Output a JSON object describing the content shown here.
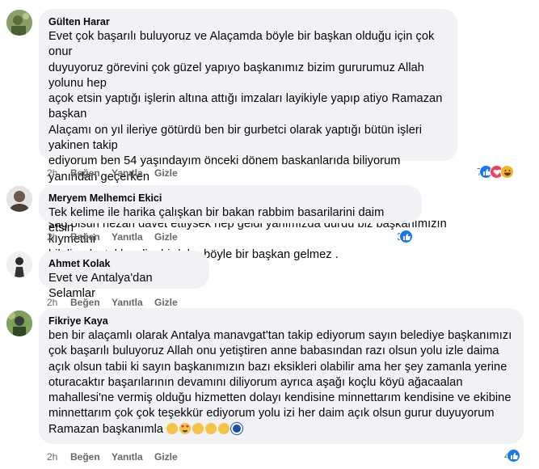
{
  "comments": [
    {
      "author": "Gülten Harar",
      "text": "Evet çok başarılı buluyoruz ve Alaçamda böyle bir başkan olduğu için çok onur\nduyuyoruz görevini çok güzel yapıyo başkanımız bizim gururumuz Allah yolunu hep\naçok etsin yaptığı işlerin altına attığı imzaları layikiyle yapıp atiyo Ramazan başkan\nAlaçamı on yıl ileriye götürdü ben bir gurbetci olarak yaptığı bütün işleri yakinen takip\nediyorum ben 54 yaşındayım önceki dönem baskanlarıda biliyorum yanından geçerken\nbir selam bile veremezdik şimdi ise halkın içinde bizim istanbulda çok etkinliğimiz oldu\nsağ olsun nezan davet ettiysek hep geldi yanımızda durdu biz başkanımızın kıymetini\nbilelim destekleyelim birdaha böyle bir başkan gelmez .",
      "time": "2h",
      "like": "Beğen",
      "reply": "Yanıtla",
      "hide": "Gizle",
      "reaction_count": "7",
      "reactions": [
        "like-icon",
        "love-icon",
        "haha-icon"
      ]
    },
    {
      "author": "Meryem Melhemci Ekici",
      "text": "Tek kelime ile harika çalışkan bir bakan rabbim basarilarini daim etsin",
      "time": "2h",
      "like": "Beğen",
      "reply": "Yanıtla",
      "hide": "Gizle",
      "reaction_count": "3",
      "reactions": [
        "like-icon"
      ]
    },
    {
      "author": "Ahmet Kolak",
      "text": "Evet ve Antalya'dan Selamlar",
      "time": "2h",
      "like": "Beğen",
      "reply": "Yanıtla",
      "hide": "Gizle",
      "reaction_count": "",
      "reactions": []
    },
    {
      "author": "Fikriye Kaya",
      "text": "ben bir alaçamlı olarak Antalya manavgat'tan takip ediyorum sayın belediye başkanımızı\nçok başarılı buluyoruz Allah onu yetiştiren anne babasından razı olsun yolu izle daima\naçık olsun tabii ki sayın başkanımızın bazı eksikleri olabilir ama her şey zamanla yerine\noturacaktır başarılarının devamını diliyorum ayrıca aşağı koçlu köyü ağacaalan\nmahallesi'ne vermiş olduğu hizmetten dolayı kendisine minnettarım kendisine ve ekibine\nminnettarım çok çok teşekkür ediyorum yolu izi her daim açık olsun gurur duyuyorum\nRamazan başkanımla",
      "text_emojis": [
        "clap-icon",
        "heart-eyes-icon",
        "clap-icon",
        "clap-icon",
        "clap-icon",
        "evil-eye-icon"
      ],
      "time": "2h",
      "like": "Beğen",
      "reply": "Yanıtla",
      "hide": "Gizle",
      "reaction_count": "4",
      "reactions": [
        "like-icon"
      ]
    }
  ],
  "colors": {
    "bubble": "#f0f2f5",
    "text": "#050505",
    "secondary": "#65676b",
    "like": "#1877f2",
    "love": "#f33e58",
    "haha": "#f7b125"
  }
}
